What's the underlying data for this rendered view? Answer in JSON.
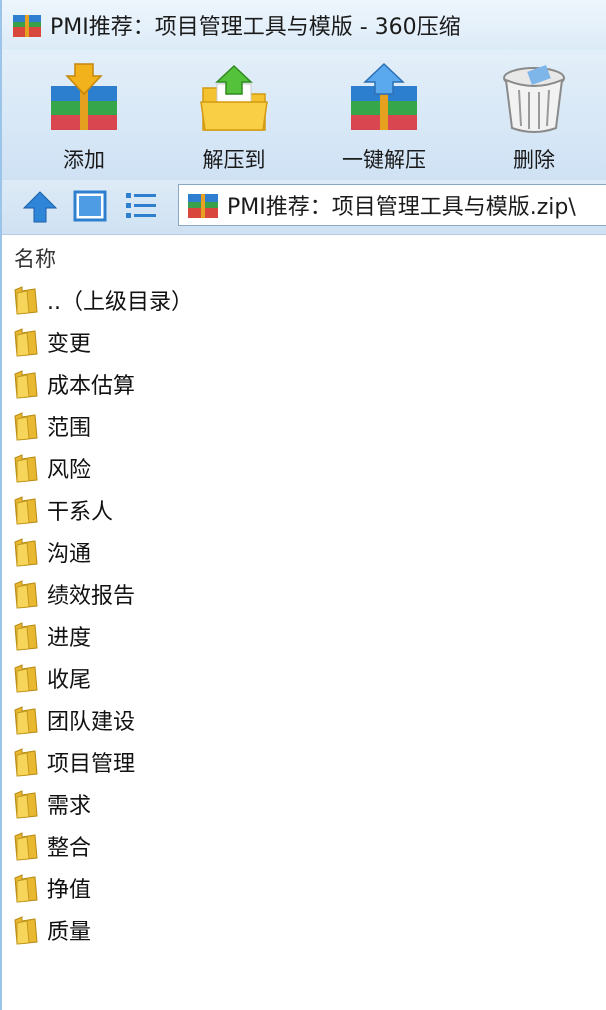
{
  "window": {
    "title": "PMI推荐：项目管理工具与模版 - 360压缩"
  },
  "toolbar": {
    "add_label": "添加",
    "extract_to_label": "解压到",
    "one_click_extract_label": "一键解压",
    "delete_label": "删除"
  },
  "navbar": {
    "path": "PMI推荐：项目管理工具与模版.zip\\"
  },
  "list": {
    "column_name": "名称",
    "items": [
      "..（上级目录）",
      "变更",
      "成本估算",
      "范围",
      "风险",
      "干系人",
      "沟通",
      "绩效报告",
      "进度",
      "收尾",
      "团队建设",
      "项目管理",
      "需求",
      "整合",
      "挣值",
      "质量"
    ]
  }
}
